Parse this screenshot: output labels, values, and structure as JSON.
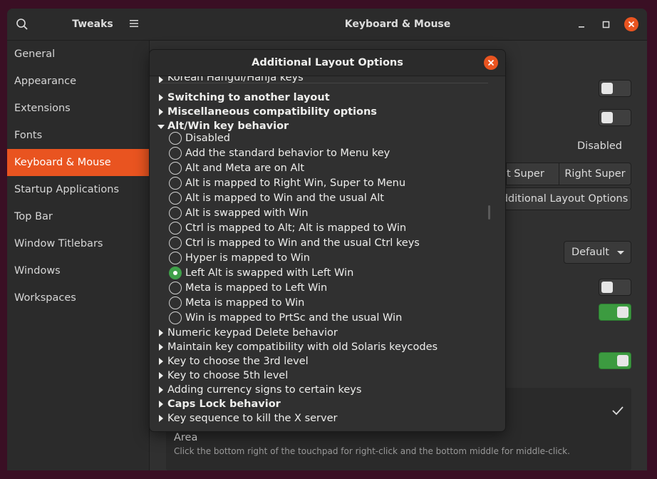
{
  "app": {
    "sidebar_title": "Tweaks",
    "page_title": "Keyboard & Mouse"
  },
  "sidebar": {
    "items": [
      {
        "label": "General"
      },
      {
        "label": "Appearance"
      },
      {
        "label": "Extensions"
      },
      {
        "label": "Fonts"
      },
      {
        "label": "Keyboard & Mouse",
        "active": true
      },
      {
        "label": "Startup Applications"
      },
      {
        "label": "Top Bar"
      },
      {
        "label": "Window Titlebars"
      },
      {
        "label": "Windows"
      },
      {
        "label": "Workspaces"
      }
    ]
  },
  "content": {
    "disabled_value": "Disabled",
    "left_super_partial": "t Super",
    "right_super": "Right Super",
    "additional_layout_partial": "dditional Layout Options",
    "default_dropdown": "Default",
    "toggles": [
      "off",
      "off",
      "off",
      "on",
      "on"
    ],
    "area_title": "Area",
    "area_desc": "Click the bottom right of the touchpad for right-click and the bottom middle for middle-click."
  },
  "dialog": {
    "title": "Additional Layout Options",
    "rows_before": [
      {
        "label": "Korean Hangul/Hanja keys",
        "bold": false
      },
      {
        "label": "Switching to another layout",
        "bold": true
      },
      {
        "label": "Miscellaneous compatibility options",
        "bold": true
      }
    ],
    "expanded": {
      "label": "Alt/Win key behavior",
      "bold": true
    },
    "options": [
      {
        "label": "Disabled",
        "checked": false
      },
      {
        "label": "Add the standard behavior to Menu key",
        "checked": false
      },
      {
        "label": "Alt and Meta are on Alt",
        "checked": false
      },
      {
        "label": "Alt is mapped to Right Win, Super to Menu",
        "checked": false
      },
      {
        "label": "Alt is mapped to Win and the usual Alt",
        "checked": false
      },
      {
        "label": "Alt is swapped with Win",
        "checked": false
      },
      {
        "label": "Ctrl is mapped to Alt; Alt is mapped to Win",
        "checked": false
      },
      {
        "label": "Ctrl is mapped to Win and the usual Ctrl keys",
        "checked": false
      },
      {
        "label": "Hyper is mapped to Win",
        "checked": false
      },
      {
        "label": "Left Alt is swapped with Left Win",
        "checked": true
      },
      {
        "label": "Meta is mapped to Left Win",
        "checked": false
      },
      {
        "label": "Meta is mapped to Win",
        "checked": false
      },
      {
        "label": "Win is mapped to PrtSc and the usual Win",
        "checked": false
      }
    ],
    "rows_after": [
      {
        "label": "Numeric keypad Delete behavior",
        "bold": false
      },
      {
        "label": "Maintain key compatibility with old Solaris keycodes",
        "bold": false
      },
      {
        "label": "Key to choose the 3rd level",
        "bold": false
      },
      {
        "label": "Key to choose 5th level",
        "bold": false
      },
      {
        "label": "Adding currency signs to certain keys",
        "bold": false
      },
      {
        "label": "Caps Lock behavior",
        "bold": true
      },
      {
        "label": "Key sequence to kill the X server",
        "bold": false
      }
    ]
  },
  "colors": {
    "accent": "#e95420",
    "toggle_on": "#3c9b40",
    "radio_checked": "#3fa049"
  },
  "icons": [
    "search-icon",
    "hamburger-menu-icon",
    "minimize-icon",
    "maximize-icon",
    "close-icon",
    "expander-arrow-icon",
    "checkmark-icon"
  ]
}
